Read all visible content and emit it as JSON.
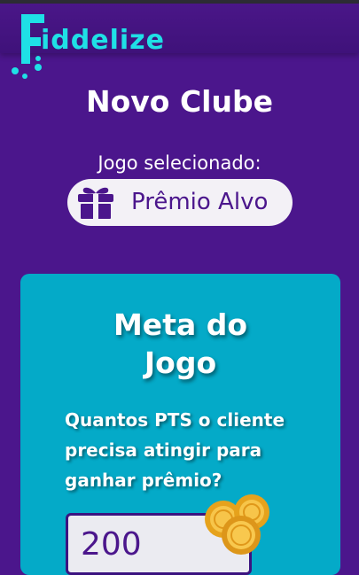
{
  "brand": {
    "logo_text": "iddelize",
    "logo_name": "Fiddelize"
  },
  "page": {
    "title": "Novo Clube"
  },
  "selection": {
    "label": "Jogo selecionado:",
    "game": "Prêmio Alvo",
    "icon": "gift-icon"
  },
  "goal_card": {
    "title_line1": "Meta do",
    "title_line2": "Jogo",
    "question": "Quantos PTS o cliente precisa atingir para ganhar prêmio?",
    "points_value": "200",
    "icon": "coins-icon"
  },
  "colors": {
    "background": "#4b168c",
    "brand_cyan": "#1fe0e6",
    "card": "#04aac8",
    "pill": "#f3f1f6",
    "coin": "#f5b82a"
  }
}
